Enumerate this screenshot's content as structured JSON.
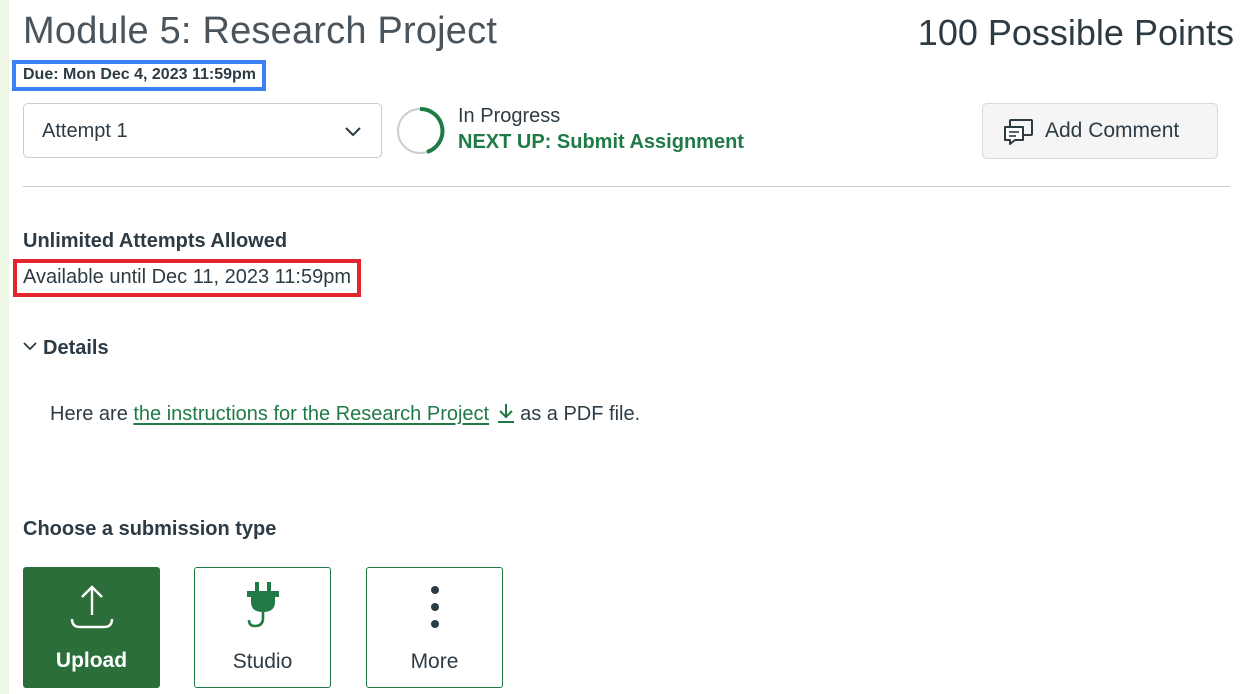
{
  "assignment": {
    "title": "Module 5: Research Project",
    "points": "100 Possible Points",
    "due": "Due: Mon Dec 4, 2023 11:59pm"
  },
  "attempt": {
    "selected": "Attempt 1"
  },
  "progress": {
    "status": "In Progress",
    "next_up": "NEXT UP: Submit Assignment"
  },
  "comment_button": "Add Comment",
  "availability": {
    "attempts": "Unlimited Attempts Allowed",
    "available_until": "Available until Dec 11, 2023 11:59pm"
  },
  "details": {
    "toggle_label": "Details",
    "text_before": "Here are ",
    "link_text": "the instructions for the Research Project",
    "text_after": "as a PDF file."
  },
  "submission": {
    "heading": "Choose a submission type",
    "types": [
      {
        "label": "Upload",
        "icon": "upload-icon"
      },
      {
        "label": "Studio",
        "icon": "plug-icon"
      },
      {
        "label": "More",
        "icon": "more-vertical-icon"
      }
    ]
  },
  "colors": {
    "accent_green": "#1f7a46",
    "upload_bg": "#2c6e3a",
    "due_highlight": "#3b82f6",
    "available_highlight": "#e3262e"
  }
}
